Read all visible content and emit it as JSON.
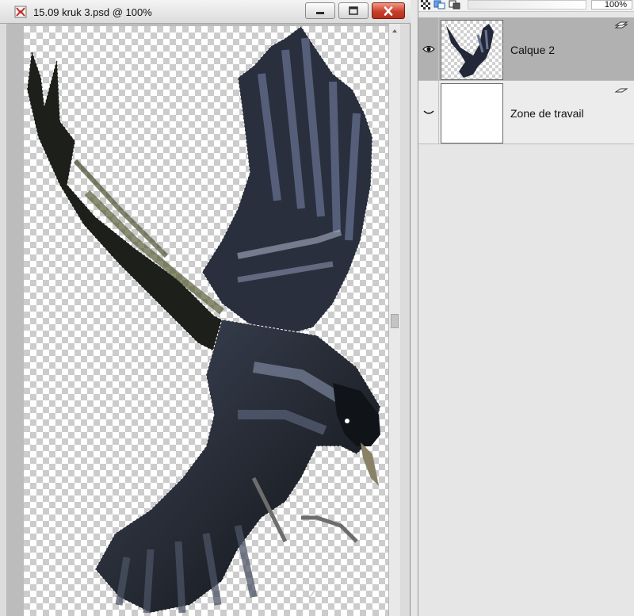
{
  "document": {
    "title": "15.09 kruk 3.psd @ 100%"
  },
  "layers_panel": {
    "opacity": "100%",
    "layers": [
      {
        "name": "Calque 2",
        "selected": true,
        "visible": true
      },
      {
        "name": "Zone de travail",
        "selected": false,
        "visible": false
      }
    ]
  },
  "colors": {
    "close_button": "#c7402c",
    "selected_layer": "#b1b1b1",
    "panel_bg": "#e6e6e6",
    "checker": "#cccccc"
  },
  "icons": {
    "app": "psd-file-icon",
    "minimize": "minimize-icon",
    "maximize": "maximize-icon",
    "close": "close-icon",
    "visibility_on": "eye-icon",
    "visibility_off": "eye-closed-icon",
    "lock": "lock-icon",
    "link": "link-icon",
    "merge": "merge-icon"
  }
}
